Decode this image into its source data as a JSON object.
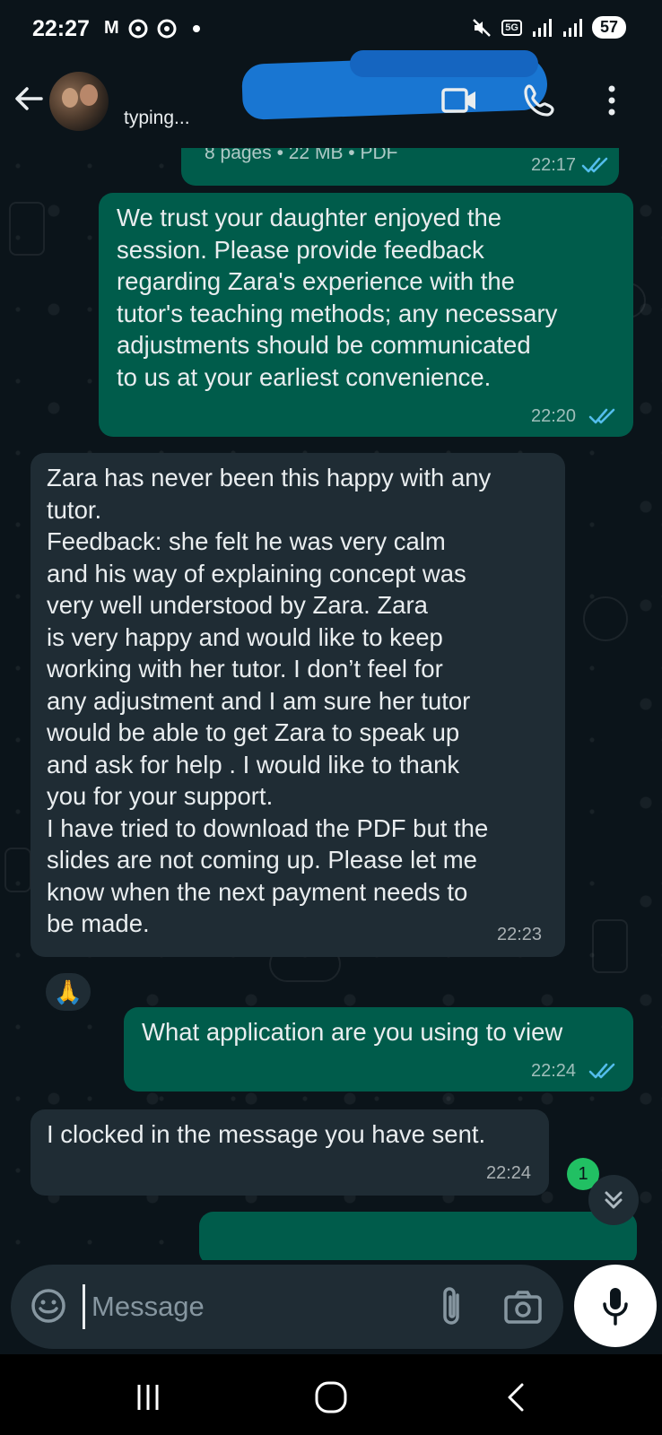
{
  "status_bar": {
    "time": "22:27",
    "gmail_icon": "M",
    "battery": "57",
    "network": "5G"
  },
  "header": {
    "contact_name": "",
    "status": "typing..."
  },
  "messages": [
    {
      "side": "out",
      "text": "8 pages • 22 MB • PDF",
      "time": "22:17",
      "read": true
    },
    {
      "side": "out",
      "text": "We trust your daughter enjoyed the\nsession.  Please provide feedback\nregarding Zara's experience with the\ntutor's teaching methods; any necessary\nadjustments should be communicated\nto us at your earliest convenience.",
      "time": "22:20",
      "read": true
    },
    {
      "side": "in",
      "text": "Zara has never been this happy with any\ntutor.\nFeedback: she felt he was very calm\nand his way of explaining concept was\nvery well understood by Zara. Zara\nis very happy and would like to keep\nworking with her tutor. I don’t feel for\nany adjustment and I am sure her tutor\nwould be able to get Zara to speak up\nand ask for help . I would like to thank\nyou for your support.\nI have tried to download the PDF but the\nslides are not coming up. Please let me\nknow when the next payment needs to\nbe made.",
      "time": "22:23",
      "reaction": "🙏"
    },
    {
      "side": "out",
      "text": "What application are you using to view",
      "time": "22:24",
      "read": true
    },
    {
      "side": "in",
      "text": "I clocked in the message you have sent.",
      "time": "22:24"
    }
  ],
  "unread_count": "1",
  "composer": {
    "placeholder": "Message"
  },
  "colors": {
    "background": "#0b141a",
    "outgoing_bubble": "#005c4b",
    "incoming_bubble": "#1f2c34",
    "read_ticks": "#53bdeb",
    "unread_badge": "#21c063"
  },
  "icons": {
    "back": "arrow-left-icon",
    "video": "video-call-icon",
    "call": "phone-icon",
    "menu": "more-vertical-icon",
    "emoji": "sticker-icon",
    "attach": "paperclip-icon",
    "camera": "camera-icon",
    "mic": "microphone-icon",
    "scroll": "chevrons-down-icon"
  }
}
